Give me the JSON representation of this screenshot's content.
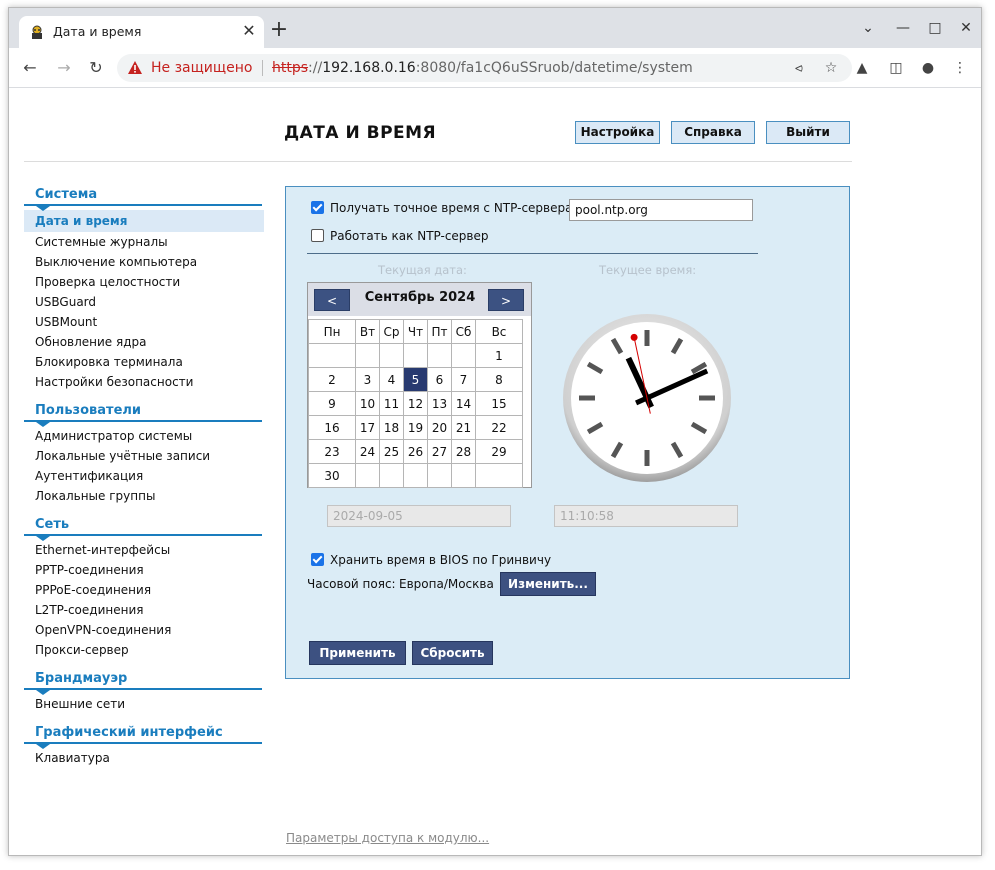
{
  "browser": {
    "tab_title": "Дата и время",
    "tab_close": "✕",
    "new_tab": "+",
    "not_secure": "Не защищено",
    "url_scheme": "https",
    "url_sep": "://",
    "url_host": "192.168.0.16",
    "url_rest": ":8080/fa1cQ6uSSruob/datetime/system"
  },
  "header": {
    "title": "ДАТА И ВРЕМЯ",
    "settings_label": "Настройка",
    "help_label": "Справка",
    "logout_label": "Выйти"
  },
  "sidebar": {
    "sections": [
      {
        "title": "Система",
        "items": [
          "Дата и время",
          "Системные журналы",
          "Выключение компьютера",
          "Проверка целостности",
          "USBGuard",
          "USBMount",
          "Обновление ядра",
          "Блокировка терминала",
          "Настройки безопасности"
        ]
      },
      {
        "title": "Пользователи",
        "items": [
          "Администратор системы",
          "Локальные учётные записи",
          "Аутентификация",
          "Локальные группы"
        ]
      },
      {
        "title": "Сеть",
        "items": [
          "Ethernet-интерфейсы",
          "PPTP-соединения",
          "PPPoE-соединения",
          "L2TP-соединения",
          "OpenVPN-соединения",
          "Прокси-сервер"
        ]
      },
      {
        "title": "Брандмауэр",
        "items": [
          "Внешние сети"
        ]
      },
      {
        "title": "Графический интерфейс",
        "items": [
          "Клавиатура"
        ]
      }
    ]
  },
  "form": {
    "ntp_client_label": "Получать точное время с NTP-сервера:",
    "ntp_client_checked": true,
    "ntp_server_value": "pool.ntp.org",
    "ntp_server_mode_label": "Работать как NTP-сервер",
    "ntp_server_mode_checked": false,
    "current_date_caption": "Текущая дата:",
    "current_time_caption": "Текущее время:",
    "date_value": "2024-09-05",
    "time_value": "11:10:58",
    "bios_utc_label": "Хранить время в BIOS по Гринвичу",
    "bios_utc_checked": true,
    "timezone_label": "Часовой пояс:",
    "timezone_value": "Европа/Москва",
    "change_label": "Изменить...",
    "apply_label": "Применить",
    "reset_label": "Сбросить"
  },
  "calendar": {
    "prev": "<",
    "next": ">",
    "month_label": "Сентябрь 2024",
    "weekdays": [
      "Пн",
      "Вт",
      "Ср",
      "Чт",
      "Пт",
      "Сб",
      "Вс"
    ],
    "weeks": [
      [
        "",
        "",
        "",
        "",
        "",
        "",
        "1"
      ],
      [
        "2",
        "3",
        "4",
        "5",
        "6",
        "7",
        "8"
      ],
      [
        "9",
        "10",
        "11",
        "12",
        "13",
        "14",
        "15"
      ],
      [
        "16",
        "17",
        "18",
        "19",
        "20",
        "21",
        "22"
      ],
      [
        "23",
        "24",
        "25",
        "26",
        "27",
        "28",
        "29"
      ],
      [
        "30",
        "",
        "",
        "",
        "",
        "",
        ""
      ]
    ],
    "selected_day": "5"
  },
  "clock": {
    "hours": 11,
    "minutes": 10,
    "seconds": 58
  },
  "footer": {
    "access_link": "Параметры доступа к модулю..."
  },
  "colors": {
    "accent": "#1a7dbe",
    "panel_bg": "#dbecf6",
    "dark_button": "#3d5181",
    "selected_day": "#283a70"
  }
}
